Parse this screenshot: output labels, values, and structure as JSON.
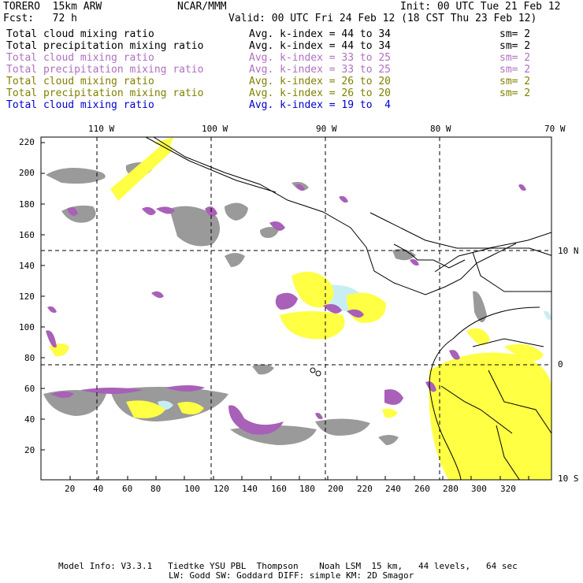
{
  "header": {
    "model": "TORERO  15km ARW",
    "org": "NCAR/MMM",
    "init": "Init: 00 UTC Tue 21 Feb 12",
    "fcst": "Fcst:   72 h",
    "valid": "Valid: 00 UTC Fri 24 Feb 12 (18 CST Thu 23 Feb 12)"
  },
  "legend": [
    {
      "name": "Total cloud mixing ratio",
      "kindex": "Avg. k-index = 44 to 34",
      "sm": "sm= 2",
      "color": "#000000"
    },
    {
      "name": "Total precipitation mixing ratio",
      "kindex": "Avg. k-index = 44 to 34",
      "sm": "sm= 2",
      "color": "#000000"
    },
    {
      "name": "Total cloud mixing ratio",
      "kindex": "Avg. k-index = 33 to 25",
      "sm": "sm= 2",
      "color": "#b070c0"
    },
    {
      "name": "Total precipitation mixing ratio",
      "kindex": "Avg. k-index = 33 to 25",
      "sm": "sm= 2",
      "color": "#b070c0"
    },
    {
      "name": "Total cloud mixing ratio",
      "kindex": "Avg. k-index = 26 to 20",
      "sm": "sm= 2",
      "color": "#808000"
    },
    {
      "name": "Total precipitation mixing ratio",
      "kindex": "Avg. k-index = 26 to 20",
      "sm": "sm= 2",
      "color": "#808000"
    },
    {
      "name": "Total cloud mixing ratio",
      "kindex": "Avg. k-index = 19 to  4",
      "sm": "",
      "color": "#0000cc"
    }
  ],
  "axes": {
    "lon_labels": [
      "110 W",
      "100 W",
      "90 W",
      "80 W",
      "70 W"
    ],
    "lat_labels": [
      "10 N",
      "0",
      "10 S"
    ],
    "x_ticks": [
      "20",
      "40",
      "60",
      "80",
      "100",
      "120",
      "140",
      "160",
      "180",
      "200",
      "220",
      "240",
      "260",
      "280",
      "300",
      "320"
    ],
    "y_ticks": [
      "220",
      "200",
      "180",
      "160",
      "140",
      "120",
      "100",
      "80",
      "60",
      "40",
      "20"
    ]
  },
  "footer": {
    "line1": "Model Info: V3.3.1   Tiedtke YSU PBL  Thompson    Noah LSM  15 km,   44 levels,   64 sec",
    "line2": "LW: Godd SW: Goddard DIFF: simple KM: 2D Smagor"
  },
  "colors": {
    "gray": "#999999",
    "purple": "#a860b8",
    "yellow": "#ffff44",
    "lightblue": "#c8eef4",
    "coast": "#000000"
  }
}
